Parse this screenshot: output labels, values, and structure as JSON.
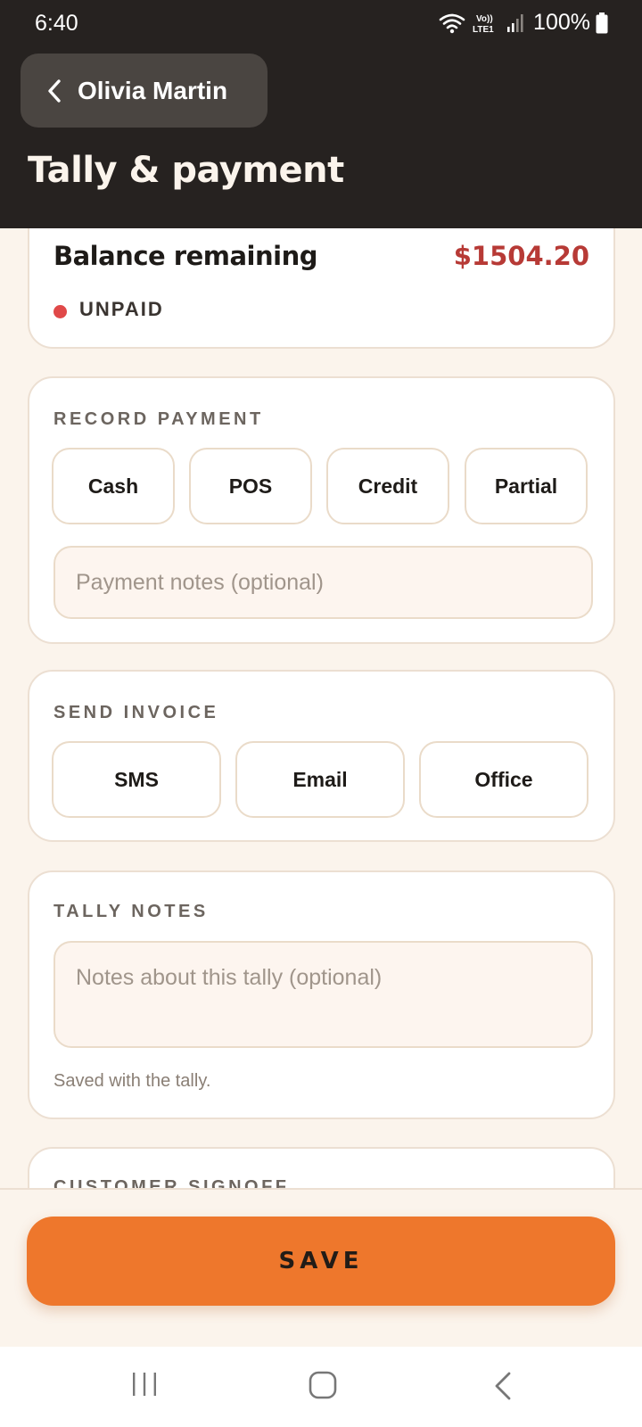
{
  "status_bar": {
    "time": "6:40",
    "network_label_top": "Vo))",
    "network_label_bottom": "LTE1",
    "battery": "100%",
    "icons": [
      "wifi-icon",
      "signal-icon",
      "battery-icon"
    ]
  },
  "header": {
    "back_label": "Olivia Martin",
    "title": "Tally & payment"
  },
  "balance": {
    "label": "Balance remaining",
    "amount": "$1504.20",
    "status": "UNPAID",
    "status_color": "#e04949"
  },
  "record_payment": {
    "label": "RECORD PAYMENT",
    "options": [
      "Cash",
      "POS",
      "Credit",
      "Partial"
    ],
    "notes_placeholder": "Payment notes (optional)"
  },
  "send_invoice": {
    "label": "SEND INVOICE",
    "options": [
      "SMS",
      "Email",
      "Office"
    ]
  },
  "tally_notes": {
    "label": "TALLY NOTES",
    "placeholder": "Notes about this tally (optional)",
    "helper": "Saved with the tally."
  },
  "customer_signoff": {
    "label": "CUSTOMER SIGNOFF"
  },
  "footer": {
    "save_label": "SAVE"
  },
  "colors": {
    "accent": "#ee772c",
    "header_bg": "#262220",
    "amount": "#b73a36",
    "page_bg": "#fbf4ec"
  }
}
